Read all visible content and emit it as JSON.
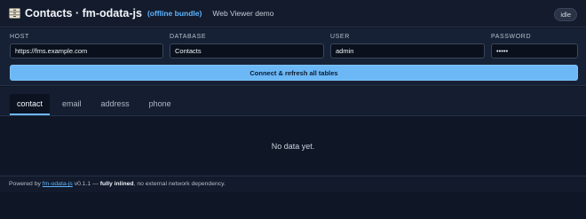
{
  "header": {
    "icon": "cabinet-icon",
    "title": "Contacts · fm-odata-js",
    "bundle_tag": "(offline bundle)",
    "subtitle": "Web Viewer demo",
    "status": "idle"
  },
  "form": {
    "host": {
      "label": "HOST",
      "value": "https://fms.example.com"
    },
    "database": {
      "label": "DATABASE",
      "value": "Contacts"
    },
    "user": {
      "label": "USER",
      "value": "admin"
    },
    "password": {
      "label": "PASSWORD",
      "value": "•••••"
    },
    "connect_label": "Connect & refresh all tables"
  },
  "tabs": [
    {
      "label": "contact",
      "active": true
    },
    {
      "label": "email",
      "active": false
    },
    {
      "label": "address",
      "active": false
    },
    {
      "label": "phone",
      "active": false
    }
  ],
  "content": {
    "empty_message": "No data yet."
  },
  "footer": {
    "prefix": "Powered by",
    "link": "fm-odata-js",
    "version": "v0.1.1 —",
    "bold": "fully inlined",
    "suffix": ", no external network dependency."
  },
  "colors": {
    "accent": "#6cb8f7",
    "background": "#0f1626",
    "link": "#5fb4ff"
  }
}
